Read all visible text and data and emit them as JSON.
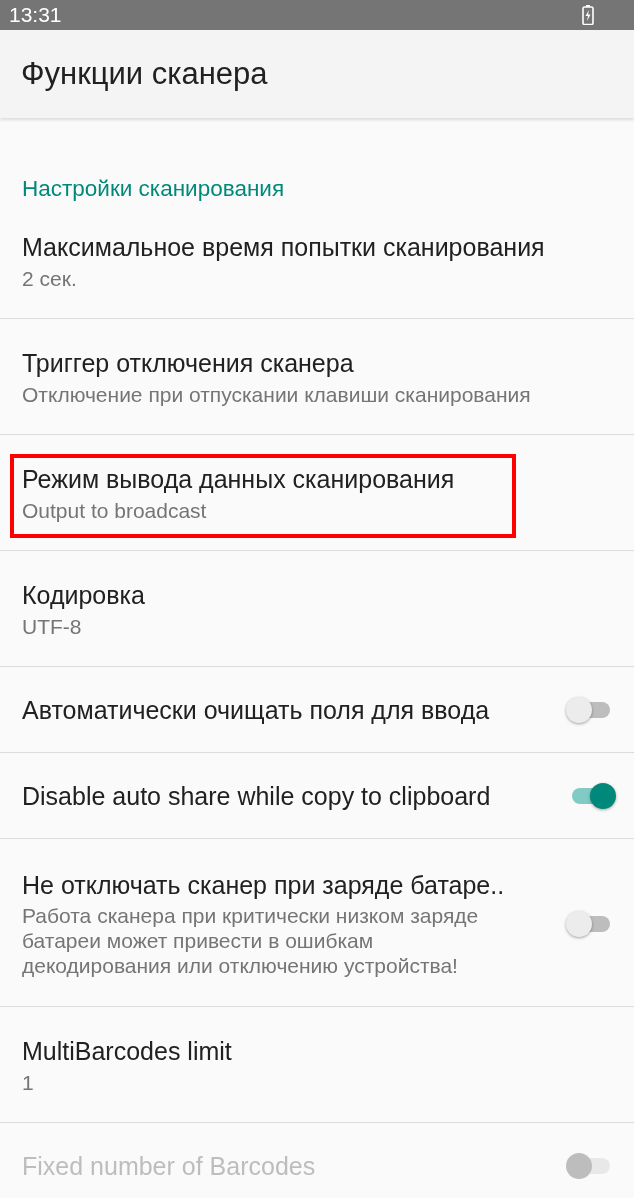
{
  "status_bar": {
    "time": "13:31"
  },
  "app_bar": {
    "title": "Функции сканера"
  },
  "section": {
    "title": "Настройки сканирования"
  },
  "items": [
    {
      "kind": "text",
      "title": "Максимальное время попытки сканирования",
      "summary": "2 сек.",
      "highlighted": false,
      "disabled": false
    },
    {
      "kind": "text",
      "title": "Триггер отключения сканера",
      "summary": "Отключение при отпускании клавиши сканирования",
      "highlighted": false,
      "disabled": false
    },
    {
      "kind": "text",
      "title": "Режим вывода данных сканирования",
      "summary": "Output to broadcast",
      "highlighted": true,
      "disabled": false
    },
    {
      "kind": "text",
      "title": "Кодировка",
      "summary": "UTF-8",
      "highlighted": false,
      "disabled": false
    },
    {
      "kind": "switch",
      "title": "Автоматически очищать поля для ввода",
      "on": false,
      "disabled": false
    },
    {
      "kind": "switch",
      "title": "Disable auto share while copy to clipboard",
      "on": true,
      "disabled": false
    },
    {
      "kind": "switch",
      "title": "Не отключать сканер при заряде батаре..",
      "summary": "Работа сканера при критически низком заряде батареи может привести в ошибкам декодирования или отключению устройства!",
      "on": false,
      "disabled": false
    },
    {
      "kind": "text",
      "title": "MultiBarcodes limit",
      "summary": "1",
      "highlighted": false,
      "disabled": false
    },
    {
      "kind": "switch",
      "title": "Fixed number of Barcodes",
      "on": false,
      "disabled": true
    }
  ]
}
